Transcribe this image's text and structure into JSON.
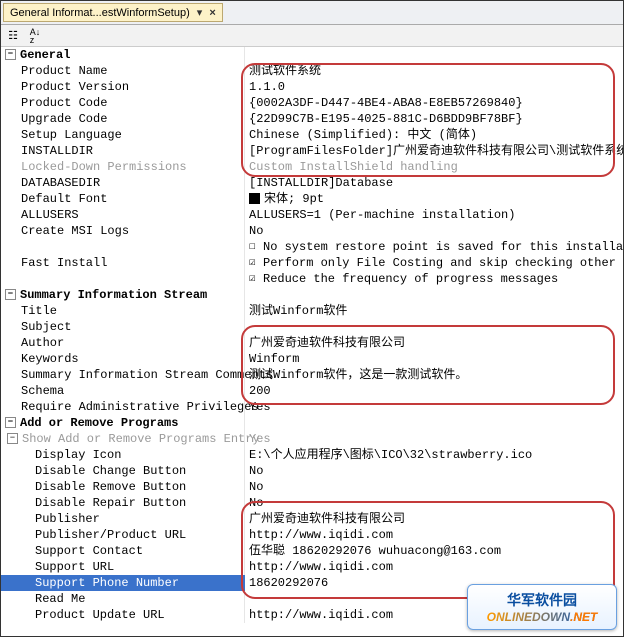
{
  "tab": {
    "title": "General Informat...estWinformSetup)"
  },
  "sections": {
    "general": {
      "label": "General"
    },
    "summary": {
      "label": "Summary Information Stream"
    },
    "arp": {
      "label": "Add or Remove Programs"
    }
  },
  "g": {
    "productName": {
      "k": "Product Name",
      "v": "测试软件系统"
    },
    "productVersion": {
      "k": "Product Version",
      "v": "1.1.0"
    },
    "productCode": {
      "k": "Product Code",
      "v": "{0002A3DF-D447-4BE4-ABA8-E8EB57269840}"
    },
    "upgradeCode": {
      "k": "Upgrade Code",
      "v": "{22D99C7B-E195-4025-881C-D6BDD9BF78BF}"
    },
    "setupLanguage": {
      "k": "Setup Language",
      "v": "Chinese (Simplified): 中文 (简体)"
    },
    "installDir": {
      "k": "INSTALLDIR",
      "v": "[ProgramFilesFolder]广州爱奇迪软件科技有限公司\\测试软件系统"
    },
    "lockedDown": {
      "k": "Locked-Down Permissions",
      "v": "Custom InstallShield handling"
    },
    "databasedir": {
      "k": "DATABASEDIR",
      "v": "[INSTALLDIR]Database"
    },
    "defaultFont": {
      "k": "Default Font",
      "v": "宋体; 9pt"
    },
    "allusers": {
      "k": "ALLUSERS",
      "v": "ALLUSERS=1 (Per-machine installation)"
    },
    "createMsiLogs": {
      "k": "Create MSI Logs",
      "v": "No"
    },
    "fastInstall": {
      "k": "Fast Install",
      "v1": "No system restore point is saved for this installation",
      "v2": "Perform only File Costing and skip checking other costs",
      "v3": "Reduce the frequency of progress messages"
    }
  },
  "s": {
    "title": {
      "k": "Title",
      "v": "测试Winform软件"
    },
    "subject": {
      "k": "Subject",
      "v": ""
    },
    "author": {
      "k": "Author",
      "v": "广州爱奇迪软件科技有限公司"
    },
    "keywords": {
      "k": "Keywords",
      "v": "  Winform"
    },
    "comments": {
      "k": "Summary Information Stream Comments",
      "v": "测试Winform软件，这是一款测试软件。"
    },
    "schema": {
      "k": "Schema",
      "v": "200"
    },
    "reqAdmin": {
      "k": "Require Administrative Privileges",
      "v": "Yes"
    }
  },
  "a": {
    "showArp": {
      "k": "Show Add or Remove Programs Entry",
      "v": "Yes"
    },
    "displayIcon": {
      "k": "Display Icon",
      "v": "E:\\个人应用程序\\图标\\ICO\\32\\strawberry.ico"
    },
    "disChange": {
      "k": "Disable Change Button",
      "v": "No"
    },
    "disRemove": {
      "k": "Disable Remove Button",
      "v": "No"
    },
    "disRepair": {
      "k": "Disable Repair Button",
      "v": "No"
    },
    "publisher": {
      "k": "Publisher",
      "v": "广州爱奇迪软件科技有限公司"
    },
    "pubUrl": {
      "k": "Publisher/Product URL",
      "v": "http://www.iqidi.com"
    },
    "supContact": {
      "k": "Support Contact",
      "v": "伍华聪 18620292076 wuhuacong@163.com"
    },
    "supUrl": {
      "k": "Support URL",
      "v": "http://www.iqidi.com"
    },
    "supPhone": {
      "k": "Support Phone Number",
      "v": "18620292076"
    },
    "readme": {
      "k": "Read Me",
      "v": ""
    },
    "updUrl": {
      "k": "Product Update URL",
      "v": "http://www.iqidi.com"
    }
  },
  "watermark": {
    "line1": "华军软件园",
    "line2": "ONLINEDOWN",
    "line2b": ".NET"
  }
}
